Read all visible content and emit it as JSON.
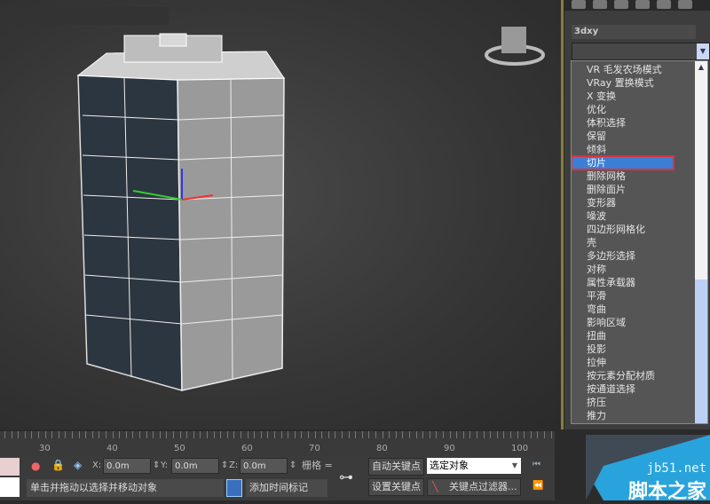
{
  "panel": {
    "object_name": "3dxy"
  },
  "modifier_list": {
    "items": [
      "VR 毛发农场模式",
      "VRay 置换模式",
      "X 变换",
      "优化",
      "体积选择",
      "保留",
      "倾斜",
      "切片",
      "删除网格",
      "删除面片",
      "变形器",
      "噪波",
      "四边形网格化",
      "壳",
      "多边形选择",
      "对称",
      "属性承载器",
      "平滑",
      "弯曲",
      "影响区域",
      "扭曲",
      "投影",
      "拉伸",
      "按元素分配材质",
      "按通道选择",
      "挤压",
      "推力"
    ],
    "selected_index": 7
  },
  "timeline": {
    "labels": [
      "30",
      "40",
      "50",
      "60",
      "70",
      "80",
      "90",
      "100"
    ]
  },
  "toolbar": {
    "x_label": "X:",
    "x_value": "0.0m",
    "y_label": "Y:",
    "y_value": "0.0m",
    "z_label": "Z:",
    "z_value": "0.0m",
    "grid_label": "栅格 =",
    "auto_key": "自动关键点",
    "set_key": "设置关键点",
    "selection_set": "选定对象",
    "key_filters": "关键点过滤器...",
    "status": "单击并拖动以选择并移动对象",
    "add_time_tag": "添加时间标记"
  },
  "watermark": {
    "site": "jb51.net",
    "name": "脚本之家"
  },
  "colors": {
    "selection": "#3a7fd5",
    "highlight_box": "#e0303a",
    "watermark": "#29a3dc"
  }
}
